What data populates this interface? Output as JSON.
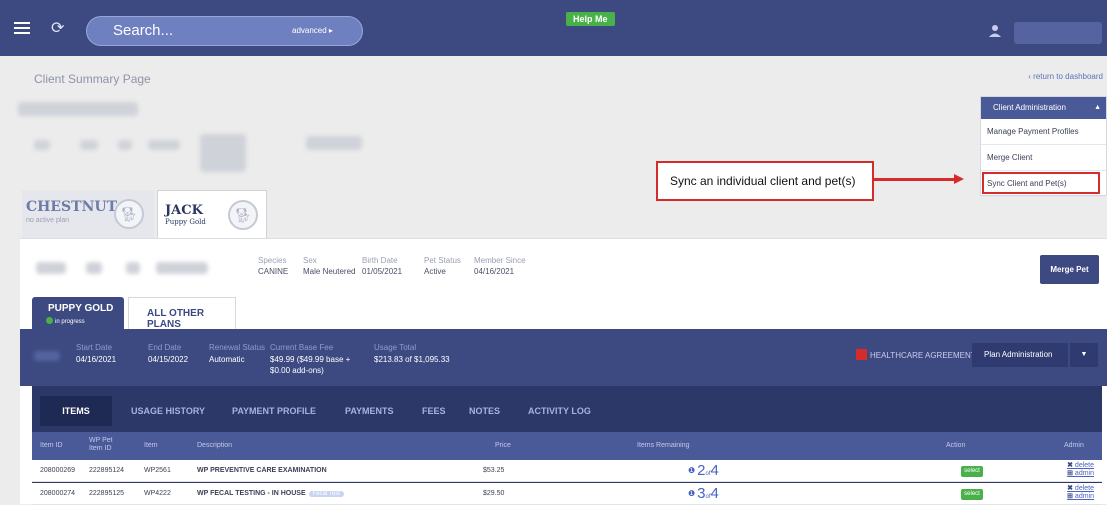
{
  "header": {
    "search_placeholder": "Search...",
    "advanced_label": "advanced ▸",
    "help_label": "Help Me"
  },
  "page": {
    "title": "Client Summary Page",
    "return_link": "‹ return to dashboard"
  },
  "client_admin": {
    "title": "Client Administration",
    "caret": "▲",
    "items": [
      "Manage Payment Profiles",
      "Merge Client",
      "Sync Client and Pet(s)"
    ]
  },
  "callout": {
    "text": "Sync an individual client and pet(s)"
  },
  "pets": [
    {
      "name": "CHESTNUT",
      "sub": "no active plan"
    },
    {
      "name": "JACK",
      "sub": "Puppy Gold"
    }
  ],
  "pet_info": {
    "species_label": "Species",
    "species": "CANINE",
    "sex_label": "Sex",
    "sex": "Male Neutered",
    "birth_label": "Birth Date",
    "birth": "01/05/2021",
    "status_label": "Pet Status",
    "status": "Active",
    "member_label": "Member Since",
    "member": "04/16/2021",
    "merge_label": "Merge Pet"
  },
  "plan_tabs": {
    "active": "PUPPY GOLD",
    "active_status": "in progress",
    "other": "ALL OTHER PLANS"
  },
  "plan": {
    "start_label": "Start Date",
    "start": "04/16/2021",
    "end_label": "End Date",
    "end": "04/15/2022",
    "renewal_label": "Renewal Status",
    "renewal": "Automatic",
    "fee_label": "Current Base Fee",
    "fee_line1": "$49.99 ($49.99 base +",
    "fee_line2": "$0.00 add-ons)",
    "usage_label": "Usage Total",
    "usage": "$213.83 of $1,095.33",
    "agreement_label": "HEALTHCARE AGREEMENT",
    "admin_label": "Plan Administration",
    "admin_caret": "▼"
  },
  "item_tabs": [
    "ITEMS",
    "USAGE HISTORY",
    "PAYMENT PROFILE",
    "PAYMENTS",
    "FEES",
    "NOTES",
    "ACTIVITY LOG"
  ],
  "table": {
    "headers": {
      "item_id": "Item ID",
      "wp_pet_1": "WP Pet",
      "wp_pet_2": "Item ID",
      "item": "Item",
      "description": "Description",
      "price": "Price",
      "remaining": "Items Remaining",
      "action": "Action",
      "admin": "Admin"
    },
    "rows": [
      {
        "item_id": "208000269",
        "wp_pet_id": "222895124",
        "item": "WP2561",
        "description": "WP PREVENTIVE CARE EXAMINATION",
        "tag": "",
        "price": "$53.25",
        "remaining": "2",
        "of": "of",
        "total": "4",
        "action": "select",
        "delete": "delete",
        "admin": "admin"
      },
      {
        "item_id": "208000274",
        "wp_pet_id": "222895125",
        "item": "WP4222",
        "description": "WP FECAL TESTING - IN HOUSE",
        "tag": "Fecal Test",
        "price": "$29.50",
        "remaining": "3",
        "of": "of",
        "total": "4",
        "action": "select",
        "delete": "delete",
        "admin": "admin"
      }
    ]
  }
}
